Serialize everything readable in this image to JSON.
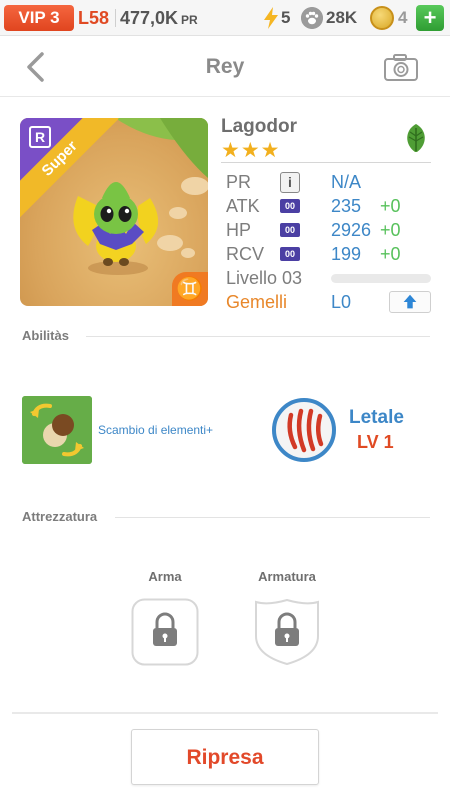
{
  "status_bar": {
    "vip": "VIP 3",
    "level": "L58",
    "power_value": "477,0K",
    "power_unit": "PR",
    "energy": "5",
    "paws": "28K",
    "coins": "4",
    "add_button": "+"
  },
  "header": {
    "title": "Rey",
    "back_icon": "chevron-left-icon",
    "camera_icon": "camera-icon"
  },
  "pet": {
    "name": "Lagodor",
    "stars": "★★★",
    "rarity_badge": "R",
    "ribbon": "Super",
    "element_icon": "leaf-icon",
    "zodiac_symbol": "♊",
    "stats": {
      "pr_label": "PR",
      "pr_value": "N/A",
      "atk_label": "ATK",
      "atk_value": "235",
      "atk_bonus": "+0",
      "hp_label": "HP",
      "hp_value": "2926",
      "hp_bonus": "+0",
      "rcv_label": "RCV",
      "rcv_value": "199",
      "rcv_bonus": "+0",
      "chip_text": "00",
      "level_label": "Livello 03",
      "level_progress": 0,
      "twin_label": "Gemelli",
      "twin_value": "L0"
    }
  },
  "abilities": {
    "section_title": "Abilitàs",
    "skill1": {
      "name": "Scambio di elementi+"
    },
    "skill2": {
      "name": "Letale",
      "level": "LV 1"
    }
  },
  "equipment": {
    "section_title": "Attrezzatura",
    "weapon_label": "Arma",
    "armor_label": "Armatura"
  },
  "footer": {
    "button_label": "Ripresa"
  },
  "colors": {
    "accent_blue": "#3d87c7",
    "accent_orange": "#e04a23",
    "bonus_green": "#57c15b",
    "star_gold": "#f2b01e"
  }
}
